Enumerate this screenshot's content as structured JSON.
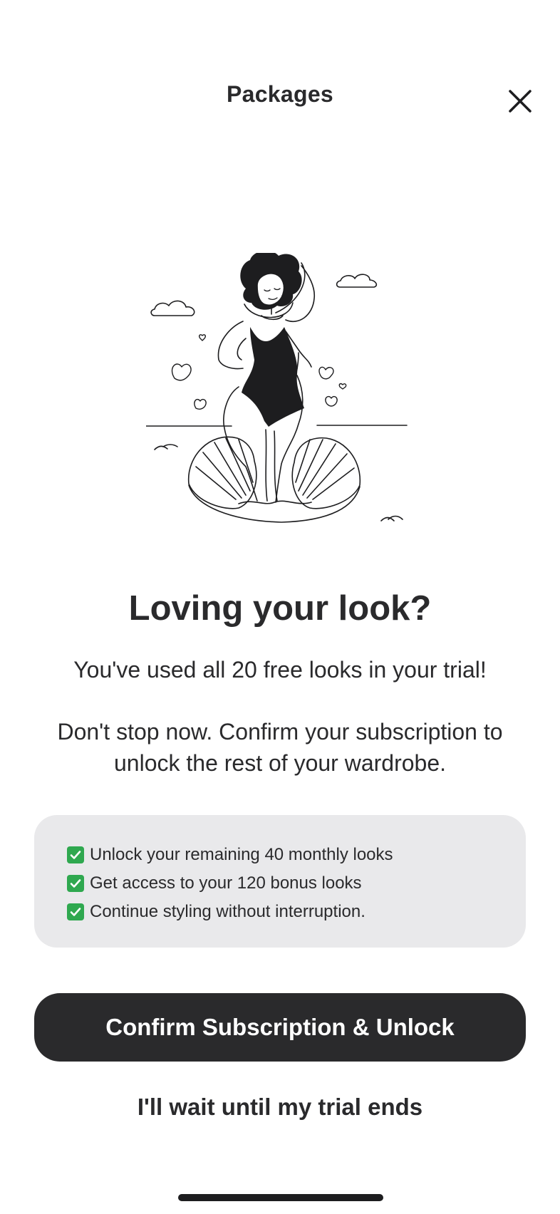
{
  "header": {
    "title": "Packages"
  },
  "icons": {
    "close": "close-icon",
    "check": "check-mark-icon"
  },
  "main": {
    "headline": "Loving your look?",
    "used_text": "You've used all 20 free looks in your trial!",
    "prompt_text": "Don't stop now. Confirm your subscription to unlock the rest of your wardrobe."
  },
  "benefits": [
    "Unlock your remaining 40 monthly looks",
    "Get access to your 120 bonus looks",
    "Continue styling without interruption."
  ],
  "actions": {
    "confirm_label": "Confirm Subscription & Unlock",
    "wait_label": "I'll wait until my trial ends"
  },
  "colors": {
    "primary": "#2a2a2c",
    "card_bg": "#e9e9eb",
    "check_green": "#2fa84f"
  }
}
